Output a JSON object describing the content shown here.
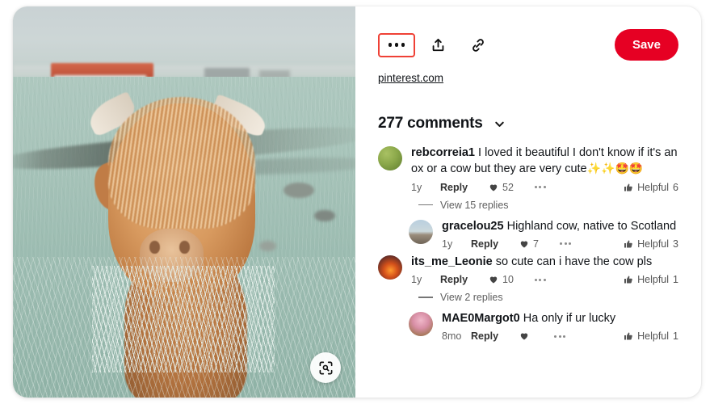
{
  "source": {
    "label": "pinterest.com"
  },
  "actions": {
    "more_options_label": "More options",
    "share_label": "Share",
    "copy_link_label": "Copy link",
    "save_label": "Save",
    "visual_search_label": "Visual search"
  },
  "colors": {
    "brand_red": "#e60023",
    "highlight_outline": "#ef4136",
    "text_primary": "#111418",
    "text_muted": "#5f5f5f"
  },
  "comments_header": {
    "count_label": "277 comments",
    "chevron": "chevron-down-icon"
  },
  "comments": [
    {
      "user": "rebcorreia1",
      "text": " I loved it beautiful I don't know if it's an ox or a cow but they are very cute",
      "emoji": "✨✨🤩🤩",
      "time": "1y",
      "reply_label": "Reply",
      "likes": "52",
      "helpful_label": "Helpful",
      "helpful_count": "6",
      "avatar": "av-green",
      "is_reply": false,
      "view_replies": "View 15 replies"
    },
    {
      "user": "gracelou25",
      "text": " Highland cow, native to Scotland",
      "emoji": "",
      "time": "1y",
      "reply_label": "Reply",
      "likes": "7",
      "helpful_label": "Helpful",
      "helpful_count": "3",
      "avatar": "av-land",
      "is_reply": true,
      "view_replies": ""
    },
    {
      "user": "its_me_Leonie",
      "text": " so cute can i have the cow pls",
      "emoji": "",
      "time": "1y",
      "reply_label": "Reply",
      "likes": "10",
      "helpful_label": "Helpful",
      "helpful_count": "1",
      "avatar": "av-sunset",
      "is_reply": false,
      "view_replies": "View 2 replies"
    },
    {
      "user": "MAE0Margot0",
      "text": " Ha only if ur lucky",
      "emoji": "",
      "time": "8mo",
      "reply_label": "Reply",
      "likes": "",
      "helpful_label": "Helpful",
      "helpful_count": "1",
      "avatar": "av-pink",
      "is_reply": true,
      "view_replies": ""
    }
  ]
}
